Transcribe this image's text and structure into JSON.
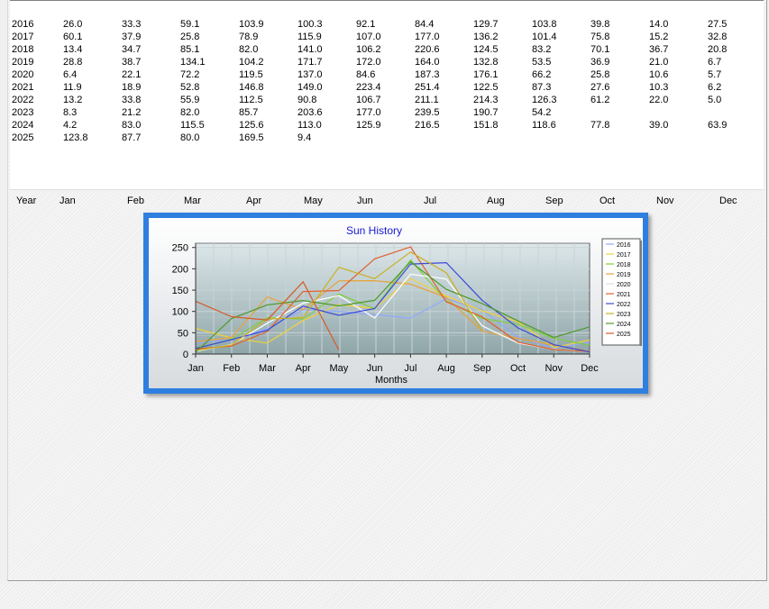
{
  "table": {
    "header": [
      "Year",
      "Jan",
      "Feb",
      "Mar",
      "Apr",
      "May",
      "Jun",
      "Jul",
      "Aug",
      "Sep",
      "Oct",
      "Nov",
      "Dec"
    ],
    "rows": [
      [
        "2016",
        "26.0",
        "33.3",
        "59.1",
        "103.9",
        "100.3",
        "92.1",
        "84.4",
        "129.7",
        "103.8",
        "39.8",
        "14.0",
        "27.5"
      ],
      [
        "2017",
        "60.1",
        "37.9",
        "25.8",
        "78.9",
        "115.9",
        "107.0",
        "177.0",
        "136.2",
        "101.4",
        "75.8",
        "15.2",
        "32.8"
      ],
      [
        "2018",
        "13.4",
        "34.7",
        "85.1",
        "82.0",
        "141.0",
        "106.2",
        "220.6",
        "124.5",
        "83.2",
        "70.1",
        "36.7",
        "20.8"
      ],
      [
        "2019",
        "28.8",
        "38.7",
        "134.1",
        "104.2",
        "171.7",
        "172.0",
        "164.0",
        "132.8",
        "53.5",
        "36.9",
        "21.0",
        "6.7"
      ],
      [
        "2020",
        "6.4",
        "22.1",
        "72.2",
        "119.5",
        "137.0",
        "84.6",
        "187.3",
        "176.1",
        "66.2",
        "25.8",
        "10.6",
        "5.7"
      ],
      [
        "2021",
        "11.9",
        "18.9",
        "52.8",
        "146.8",
        "149.0",
        "223.4",
        "251.4",
        "122.5",
        "87.3",
        "27.6",
        "10.3",
        "6.2"
      ],
      [
        "2022",
        "13.2",
        "33.8",
        "55.9",
        "112.5",
        "90.8",
        "106.7",
        "211.1",
        "214.3",
        "126.3",
        "61.2",
        "22.0",
        "5.0"
      ],
      [
        "2023",
        "8.3",
        "21.2",
        "82.0",
        "85.7",
        "203.6",
        "177.0",
        "239.5",
        "190.7",
        "54.2",
        "",
        "",
        ""
      ],
      [
        "2024",
        "4.2",
        "83.0",
        "115.5",
        "125.6",
        "113.0",
        "125.9",
        "216.5",
        "151.8",
        "118.6",
        "77.8",
        "39.0",
        "63.9"
      ],
      [
        "2025",
        "123.8",
        "87.7",
        "80.0",
        "169.5",
        "9.4",
        "",
        "",
        "",
        "",
        "",
        "",
        ""
      ]
    ]
  },
  "chart_data": {
    "type": "line",
    "title": "Sun History",
    "xlabel": "Months",
    "ylabel": "",
    "categories": [
      "Jan",
      "Feb",
      "Mar",
      "Apr",
      "May",
      "Jun",
      "Jul",
      "Aug",
      "Sep",
      "Oct",
      "Nov",
      "Dec"
    ],
    "yticks": [
      0,
      50,
      100,
      150,
      200,
      250
    ],
    "ylim": [
      0,
      260
    ],
    "grid": true,
    "legend_position": "right",
    "series": [
      {
        "name": "2016",
        "color": "#8fa8ff",
        "values": [
          26.0,
          33.3,
          59.1,
          103.9,
          100.3,
          92.1,
          84.4,
          129.7,
          103.8,
          39.8,
          14.0,
          27.5
        ]
      },
      {
        "name": "2017",
        "color": "#f0d23a",
        "values": [
          60.1,
          37.9,
          25.8,
          78.9,
          115.9,
          107.0,
          177.0,
          136.2,
          101.4,
          75.8,
          15.2,
          32.8
        ]
      },
      {
        "name": "2018",
        "color": "#7fcf3a",
        "values": [
          13.4,
          34.7,
          85.1,
          82.0,
          141.0,
          106.2,
          220.6,
          124.5,
          83.2,
          70.1,
          36.7,
          20.8
        ]
      },
      {
        "name": "2019",
        "color": "#e8a23a",
        "values": [
          28.8,
          38.7,
          134.1,
          104.2,
          171.7,
          172.0,
          164.0,
          132.8,
          53.5,
          36.9,
          21.0,
          6.7
        ]
      },
      {
        "name": "2020",
        "color": "#ffffff",
        "values": [
          6.4,
          22.1,
          72.2,
          119.5,
          137.0,
          84.6,
          187.3,
          176.1,
          66.2,
          25.8,
          10.6,
          5.7
        ]
      },
      {
        "name": "2021",
        "color": "#e06030",
        "values": [
          11.9,
          18.9,
          52.8,
          146.8,
          149.0,
          223.4,
          251.4,
          122.5,
          87.3,
          27.6,
          10.3,
          6.2
        ]
      },
      {
        "name": "2022",
        "color": "#3a4ad8",
        "values": [
          13.2,
          33.8,
          55.9,
          112.5,
          90.8,
          106.7,
          211.1,
          214.3,
          126.3,
          61.2,
          22.0,
          5.0
        ]
      },
      {
        "name": "2023",
        "color": "#c8b020",
        "values": [
          8.3,
          21.2,
          82.0,
          85.7,
          203.6,
          177.0,
          239.5,
          190.7,
          54.2,
          null,
          null,
          null
        ]
      },
      {
        "name": "2024",
        "color": "#4e9a2a",
        "values": [
          4.2,
          83.0,
          115.5,
          125.6,
          113.0,
          125.9,
          216.5,
          151.8,
          118.6,
          77.8,
          39.0,
          63.9
        ]
      },
      {
        "name": "2025",
        "color": "#d85a28",
        "values": [
          123.8,
          87.7,
          80.0,
          169.5,
          9.4,
          null,
          null,
          null,
          null,
          null,
          null,
          null
        ]
      }
    ]
  }
}
